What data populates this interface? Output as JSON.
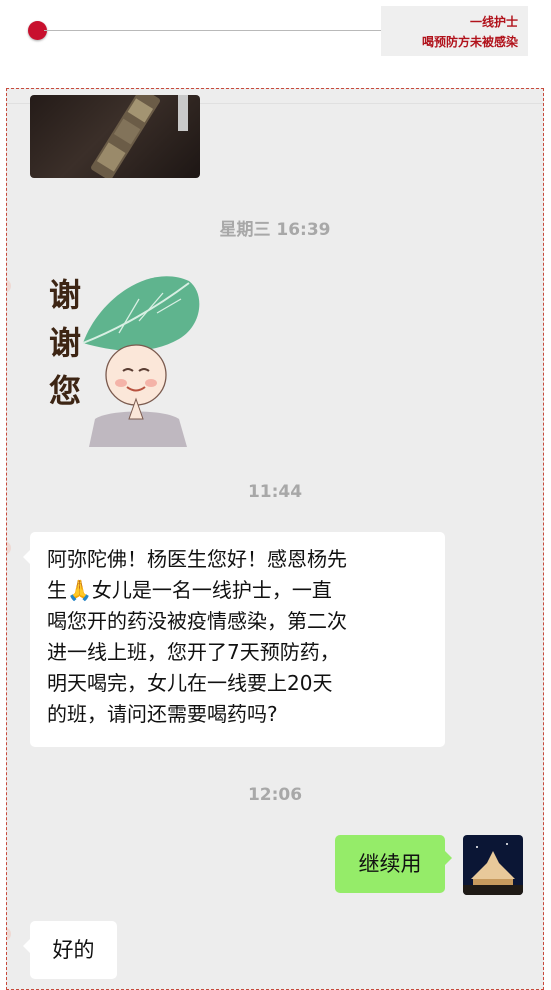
{
  "header": {
    "line1": "一线护士",
    "line2": "喝预防方未被感染"
  },
  "chat": {
    "time1": "星期三 16:39",
    "sticker_chars": [
      "谢",
      "谢",
      "您"
    ],
    "time2": "11:44",
    "message1_lines": [
      "阿弥陀佛！杨医生您好！感恩杨先",
      "生🙏女儿是一名一线护士，一直",
      "喝您开的药没被疫情感染，第二次",
      "进一线上班，您开了7天预防药，",
      "明天喝完，女儿在一线要上20天",
      "的班，请问还需要喝药吗?"
    ],
    "time3": "12:06",
    "reply": "继续用",
    "message2": "好的"
  },
  "colors": {
    "accent_red": "#c8102e",
    "tag_text": "#b1121b",
    "chat_background": "#ededed",
    "my_bubble": "#95ec69"
  }
}
